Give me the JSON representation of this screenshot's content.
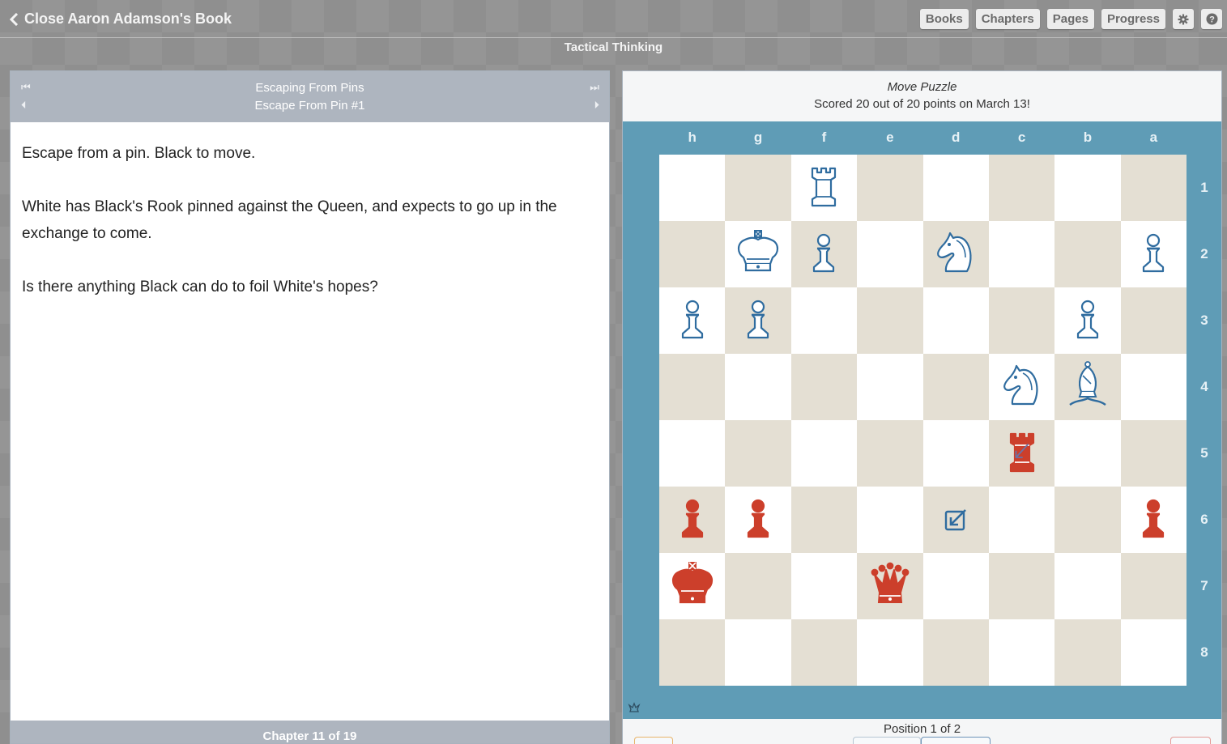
{
  "topbar": {
    "back_label": "Close Aaron Adamson's Book",
    "nav": [
      "Books",
      "Chapters",
      "Pages",
      "Progress"
    ],
    "settings_icon": "gear-icon",
    "help_icon": "help-icon"
  },
  "subtitle": "Tactical Thinking",
  "lesson": {
    "section": "Escaping From Pins",
    "title": "Escape From Pin #1",
    "paragraphs": [
      "Escape from a pin. Black to move.",
      "White has Black's Rook pinned against the Queen, and expects to go up in the exchange to come.",
      "Is there anything Black can do to foil White's hopes?"
    ],
    "footer": "Chapter 11 of 19"
  },
  "puzzle": {
    "type": "Move Puzzle",
    "score": "Scored 20 out of 20 points on March 13!",
    "files": [
      "h",
      "g",
      "f",
      "e",
      "d",
      "c",
      "b",
      "a"
    ],
    "ranks": [
      "1",
      "2",
      "3",
      "4",
      "5",
      "6",
      "7",
      "8"
    ],
    "position": "Position 1 of 2",
    "colors": {
      "white_piece": "#2f6c9f",
      "black_piece": "#cc3f2b",
      "light_sq": "#ffffff",
      "dark_sq": "#e4dfd3",
      "frame": "#5f9cb6"
    },
    "pieces": [
      {
        "square": "f1",
        "piece": "rook",
        "color": "white"
      },
      {
        "square": "g2",
        "piece": "king",
        "color": "white"
      },
      {
        "square": "f2",
        "piece": "pawn",
        "color": "white"
      },
      {
        "square": "d2",
        "piece": "knight",
        "color": "white"
      },
      {
        "square": "a2",
        "piece": "pawn",
        "color": "white"
      },
      {
        "square": "h3",
        "piece": "pawn",
        "color": "white"
      },
      {
        "square": "g3",
        "piece": "pawn",
        "color": "white"
      },
      {
        "square": "b3",
        "piece": "pawn",
        "color": "white"
      },
      {
        "square": "c4",
        "piece": "knight",
        "color": "white"
      },
      {
        "square": "b4",
        "piece": "bishop",
        "color": "white"
      },
      {
        "square": "c5",
        "piece": "rook",
        "color": "black"
      },
      {
        "square": "h6",
        "piece": "pawn",
        "color": "black"
      },
      {
        "square": "g6",
        "piece": "pawn",
        "color": "black"
      },
      {
        "square": "a6",
        "piece": "pawn",
        "color": "black"
      },
      {
        "square": "h7",
        "piece": "king",
        "color": "black"
      },
      {
        "square": "e7",
        "piece": "queen",
        "color": "black"
      }
    ],
    "markers": [
      {
        "square": "d6",
        "icon": "move-arrow-icon"
      }
    ]
  }
}
